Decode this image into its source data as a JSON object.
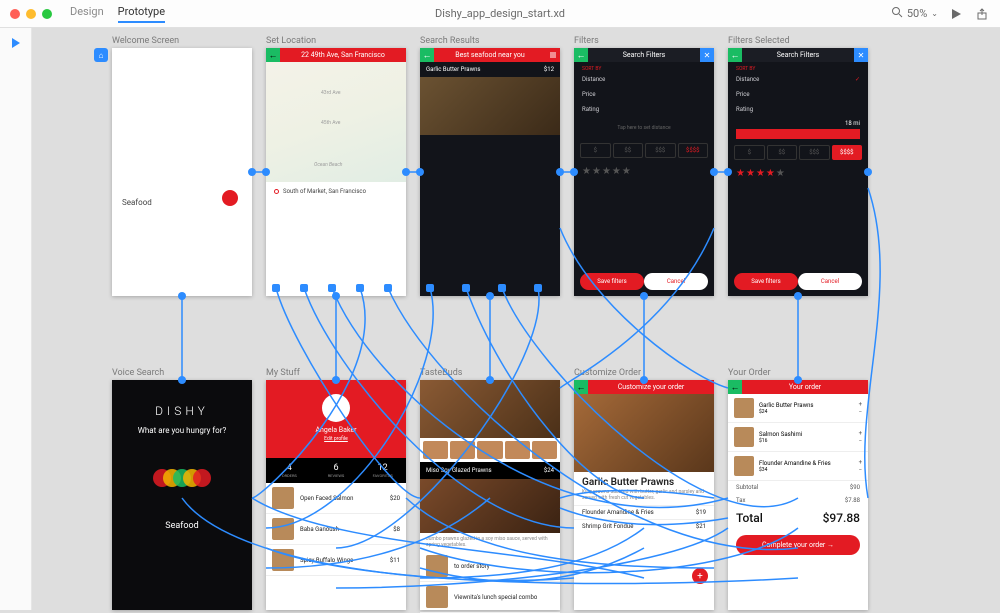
{
  "topbar": {
    "tabs": {
      "design": "Design",
      "prototype": "Prototype"
    },
    "document_title": "Dishy_app_design_start.xd",
    "zoom": "50%"
  },
  "artboards": {
    "welcome": {
      "label": "Welcome Screen",
      "field": "Seafood"
    },
    "location": {
      "label": "Set Location",
      "address": "22 49th Ave, San Francisco",
      "street1": "43rd Ave",
      "street2": "45th Ave",
      "beach": "Ocean Beach",
      "picked": "South of Market, San Francisco"
    },
    "results": {
      "label": "Search Results",
      "header": "Best seafood near you",
      "item": "Garlic Butter Prawns",
      "price": "$12"
    },
    "filters": {
      "label": "Filters",
      "header": "Search Filters",
      "section": "SORT BY",
      "opt1": "Distance",
      "opt2": "Price",
      "opt3": "Rating",
      "slider_hint": "Tap here to set distance",
      "p1": "$",
      "p2": "$$",
      "p3": "$$$",
      "p4": "$$$$",
      "save": "Save filters",
      "cancel": "Cancel"
    },
    "filters2": {
      "label": "Filters Selected",
      "distance": "18 mi"
    },
    "voice": {
      "label": "Voice Search",
      "brand": "DISHY",
      "prompt": "What are you hungry for?",
      "answer": "Seafood"
    },
    "mystuff": {
      "label": "My Stuff",
      "name": "Angela Baker",
      "edit": "Edit profile",
      "stat1_n": "4",
      "stat1_l": "ORDERS",
      "stat2_n": "6",
      "stat2_l": "REVIEWS",
      "stat3_n": "12",
      "stat3_l": "FAVORITES",
      "r1": "Open Faced Salmon",
      "r1p": "$20",
      "r2": "Baba Ganoush",
      "r2p": "$8",
      "r3": "Spicy Buffalo Wings",
      "r3p": "$11"
    },
    "tastebuds": {
      "label": "TasteBuds",
      "item": "Miso Soy Glazed Prawns",
      "price": "$24",
      "desc": "Jumbo prawns glazed in a soy miso sauce, served with spring vegetables.",
      "r1": "to order story",
      "r2": "Viewnita's lunch special combo"
    },
    "customize": {
      "label": "Customize Order",
      "header": "Customize your order",
      "title": "Garlic Butter Prawns",
      "desc": "King prawns sautéed with butter, garlic and parsley and served with fresh cut vegetables.",
      "o1": "Flounder Amandine & Fries",
      "o1p": "$19",
      "o2": "Shrimp Grit Fondue",
      "o2p": "$21"
    },
    "order": {
      "label": "Your Order",
      "header": "Your order",
      "i1": "Garlic Butter Prawns",
      "i1p": "$24",
      "i2": "Salmon Sashimi",
      "i2p": "$16",
      "i3": "Flounder Amandine & Fries",
      "i3p": "$34",
      "sub_l": "Subtotal",
      "sub_v": "$90",
      "tax_l": "Tax",
      "tax_v": "$7.88",
      "tot_l": "Total",
      "tot_v": "$97.88",
      "cta": "Complete your order   →"
    }
  }
}
